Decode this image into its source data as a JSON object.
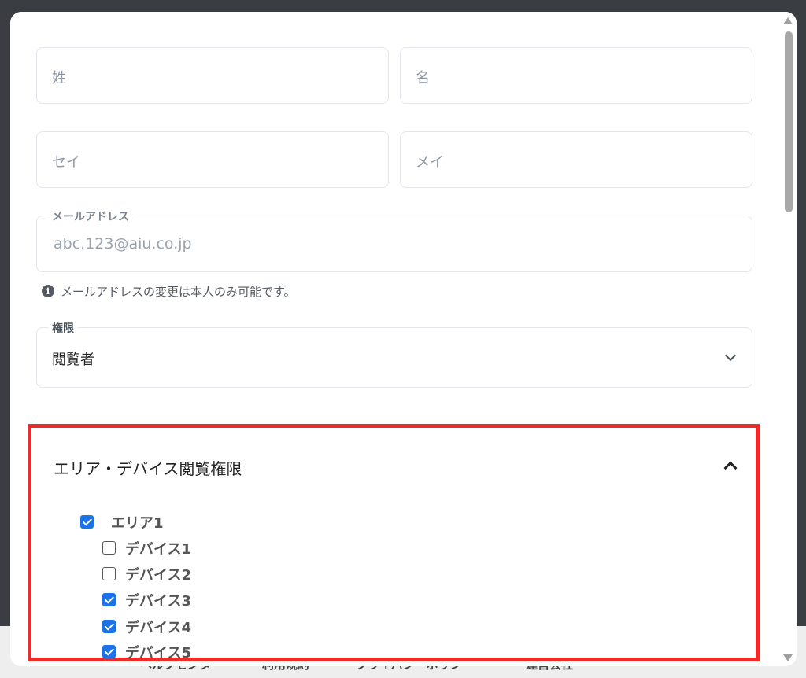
{
  "backdrop_footer": {
    "items": [
      "ヘルプセンター",
      "利用規約",
      "プライバシーポリシー",
      "運営会社"
    ]
  },
  "form": {
    "last_name_placeholder": "姓",
    "first_name_placeholder": "名",
    "last_name_kana_placeholder": "セイ",
    "first_name_kana_placeholder": "メイ",
    "email_label": "メールアドレス",
    "email_value": "abc.123@aiu.co.jp",
    "email_helper": "メールアドレスの変更は本人のみ可能です。",
    "role_label": "権限",
    "role_value": "閲覧者"
  },
  "permissions": {
    "title": "エリア・デバイス閲覧権限",
    "area": {
      "label": "エリア1",
      "checked": true
    },
    "devices": [
      {
        "label": "デバイス1",
        "checked": false
      },
      {
        "label": "デバイス2",
        "checked": false
      },
      {
        "label": "デバイス3",
        "checked": true
      },
      {
        "label": "デバイス4",
        "checked": true
      },
      {
        "label": "デバイス5",
        "checked": true
      }
    ]
  },
  "colors": {
    "accent": "#1a73e8",
    "highlight": "#ec2b2b"
  },
  "icons": {
    "info": "info-icon",
    "select_chevron": "chevron-down-icon",
    "collapse": "chevron-up-icon"
  }
}
